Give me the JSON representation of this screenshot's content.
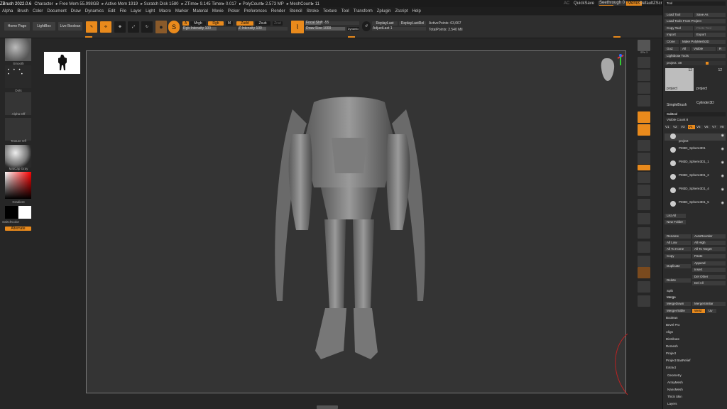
{
  "title_bar": {
    "items": [
      "ZBrush 2022.0.6",
      "Character",
      "▸ Free Mem 55.998GB",
      "▸ Active Mem 1919",
      "▸ Scratch Disk 1580",
      "▸ ZTime▸ 9.145 Timer▸ 0.017",
      "▸ PolyCount▸ 2.573 MP",
      "▸ MeshCount▸ 11"
    ],
    "ac": "AC",
    "quicksave": "QuickSave",
    "see_through": "Seethrough 0",
    "menus": "Menus",
    "default_script": "DefaultZScript"
  },
  "menu_bar": [
    "Alpha",
    "Brush",
    "Color",
    "Document",
    "Draw",
    "Dynamics",
    "Edit",
    "File",
    "Layer",
    "Light",
    "Macro",
    "Marker",
    "Material",
    "Movie",
    "Picker",
    "Preferences",
    "Render",
    "Stencil",
    "Stroke",
    "Texture",
    "Tool",
    "Transform",
    "Zplugin",
    "Zscript",
    "Help"
  ],
  "shelf": {
    "home": "Home Page",
    "lightbox": "LightBox",
    "live_boolean": "Live Boolean",
    "edit": "Edit",
    "draw": "Draw",
    "move": "Move",
    "scale": "Scale",
    "rotate": "Rotate",
    "a": "A",
    "mrgb": "Mrgb",
    "rgb": "Rgb",
    "m": "M",
    "zadd": "Zadd",
    "zsub": "Zsub",
    "zcut": "Zcut",
    "rgb_intensity": "Rgb Intensity 100",
    "z_intensity": "Z Intensity 100",
    "focal_shift": "Focal Shift -55",
    "draw_size": "Draw Size 1000",
    "dynamic": "Dynamic",
    "replay_last": "ReplayLast",
    "replay_last_rel": "ReplayLastRel",
    "adjust_last": "AdjustLast 1",
    "active_points": "ActivePoints: 63,067",
    "total_points": "TotalPoints: 2.540 Mil"
  },
  "left": {
    "smooth": "Smooth",
    "dots": "Dots",
    "alpha_off": "Alpha Off",
    "texture_off": "Texture Off",
    "matcap": "MatCap Gray",
    "gradient": "Gradient",
    "switch_color": "SwitchColor",
    "alternate": "Alternate"
  },
  "right_shelf": {
    "spix": "SPix 3",
    "labels": [
      "Dynamic",
      "Persp",
      "Floor",
      "Local",
      "Frame",
      "Move",
      "Scale",
      "Rotate",
      "Line Fill PolyF",
      "Transp",
      "Ghost",
      "Solo",
      "Xpose"
    ]
  },
  "tool_panel": {
    "header": "Tool",
    "load_tool": "Load Tool",
    "save_as": "Save As",
    "load_from_project": "Load Tools From Project",
    "copy_tool": "Copy Tool",
    "paste_tool": "Paste Tool",
    "import": "Import",
    "export": "Export",
    "clone": "Clone",
    "make_polymesh": "Make PolyMesh3D",
    "goz": "GoZ",
    "all": "All",
    "visible": "Visible",
    "r": "R",
    "lightbox_tools": "Lightbox▸ Tools",
    "project_slider": "project. 48",
    "thumbs": [
      {
        "name": "project",
        "count": "12"
      },
      {
        "name": "project",
        "count": "12"
      },
      {
        "name": "Cylinder3D",
        "count": ""
      },
      {
        "name": "SimpleBrush",
        "count": ""
      }
    ],
    "subtool_header": "Subtool",
    "visible_count": "Visible Count 8",
    "vtabs": [
      "V1",
      "V2",
      "V3",
      "V4",
      "V5",
      "V6",
      "V7",
      "V8"
    ],
    "subtools": [
      "project",
      "PM3D_Sphere3D1",
      "PM3D_Sphere3D1_1",
      "PM3D_Sphere3D1_2",
      "PM3D_Sphere3D1_4",
      "PM3D_Sphere3D1_5"
    ],
    "list_all": "List All",
    "new_folder": "New Folder",
    "rename": "Rename",
    "auto_reorder": "AutoReorder",
    "all_low": "All Low",
    "all_high": "All High",
    "all_to_home": "All To Home",
    "all_to_target": "All To Target",
    "copy": "Copy",
    "paste": "Paste",
    "duplicate": "Duplicate",
    "append": "Append",
    "insert": "Insert",
    "delete": "Delete",
    "del_other": "Del Other",
    "del_all": "Del All",
    "split": "Split",
    "merge": "Merge",
    "merge_down": "MergeDown",
    "merge_similar": "MergeSimilar",
    "merge_visible": "MergeVisible",
    "weld": "Weld",
    "uv": "Uv",
    "subs": [
      "Boolean",
      "Bevel Pro",
      "Align",
      "Distribute",
      "Remesh",
      "Project",
      "Project BasRelief",
      "Extract"
    ],
    "bottom": [
      "Geometry",
      "ArrayMesh",
      "NanoMesh",
      "Thick Skin",
      "Layers"
    ]
  }
}
